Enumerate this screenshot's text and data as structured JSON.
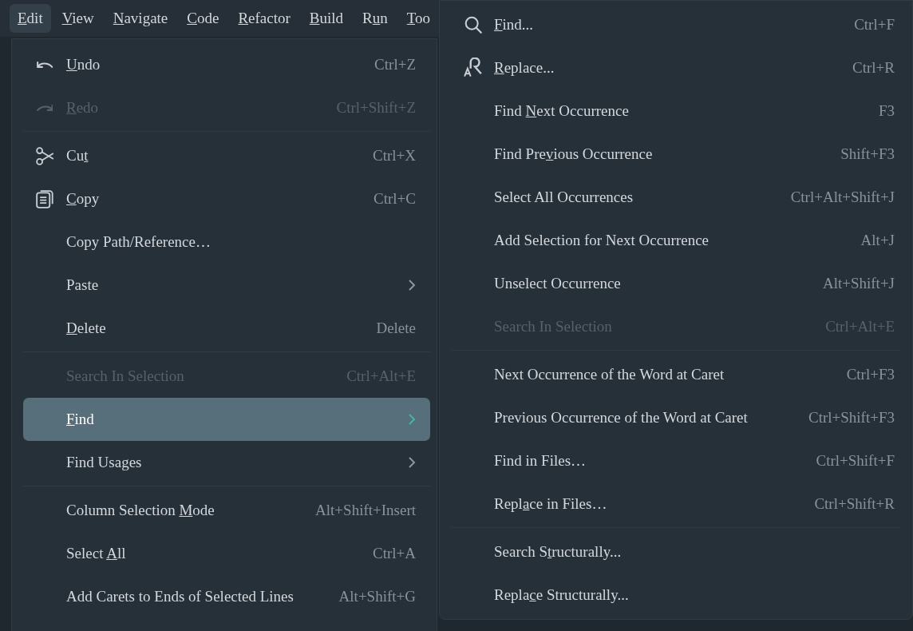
{
  "menubar": [
    {
      "label_parts": {
        "mnemonic": "E",
        "after": "dit"
      },
      "selected": true
    },
    {
      "label_parts": {
        "mnemonic": "V",
        "after": "iew"
      },
      "selected": false
    },
    {
      "label_parts": {
        "mnemonic": "N",
        "after": "avigate"
      },
      "selected": false
    },
    {
      "label_parts": {
        "mnemonic": "C",
        "after": "ode"
      },
      "selected": false
    },
    {
      "label_parts": {
        "mnemonic": "R",
        "after": "efactor"
      },
      "selected": false
    },
    {
      "label_parts": {
        "mnemonic": "B",
        "after": "uild"
      },
      "selected": false
    },
    {
      "label_parts": {
        "before": "R",
        "mnemonic": "u",
        "after": "n"
      },
      "selected": false
    },
    {
      "label_parts": {
        "mnemonic": "T",
        "after": "oo"
      },
      "selected": false
    }
  ],
  "edit_menu": [
    {
      "kind": "undo",
      "label_parts": {
        "mnemonic": "U",
        "after": "ndo"
      },
      "shortcut": "Ctrl+Z",
      "disabled": false
    },
    {
      "kind": "redo",
      "label_parts": {
        "mnemonic": "R",
        "after": "edo"
      },
      "shortcut": "Ctrl+Shift+Z",
      "disabled": true
    },
    {
      "kind": "separator"
    },
    {
      "kind": "cut",
      "label_parts": {
        "before": "Cu",
        "mnemonic": "t"
      },
      "shortcut": "Ctrl+X",
      "disabled": false
    },
    {
      "kind": "copy",
      "label_parts": {
        "mnemonic": "C",
        "after": "opy"
      },
      "shortcut": "Ctrl+C",
      "disabled": false
    },
    {
      "kind": "item",
      "label": "Copy Path/Reference…",
      "disabled": false
    },
    {
      "kind": "item",
      "label": "Paste",
      "submenu": true,
      "disabled": false
    },
    {
      "kind": "item",
      "label_parts": {
        "mnemonic": "D",
        "after": "elete"
      },
      "shortcut": "Delete",
      "disabled": false
    },
    {
      "kind": "separator"
    },
    {
      "kind": "item",
      "label": "Search In Selection",
      "shortcut": "Ctrl+Alt+E",
      "disabled": true
    },
    {
      "kind": "item",
      "label_parts": {
        "mnemonic": "F",
        "after": "ind"
      },
      "submenu": true,
      "selected": true,
      "disabled": false
    },
    {
      "kind": "item",
      "label": "Find Usages",
      "submenu": true,
      "disabled": false
    },
    {
      "kind": "separator"
    },
    {
      "kind": "item",
      "label_parts": {
        "before": "Column Selection ",
        "mnemonic": "M",
        "after": "ode"
      },
      "shortcut": "Alt+Shift+Insert",
      "disabled": false
    },
    {
      "kind": "item",
      "label_parts": {
        "before": "Select ",
        "mnemonic": "A",
        "after": "ll"
      },
      "shortcut": "Ctrl+A",
      "disabled": false
    },
    {
      "kind": "item",
      "label": "Add Carets to Ends of Selected Lines",
      "shortcut": "Alt+Shift+G",
      "disabled": false
    }
  ],
  "find_submenu": [
    {
      "kind": "search",
      "label_parts": {
        "mnemonic": "F",
        "after": "ind..."
      },
      "shortcut": "Ctrl+F",
      "disabled": false
    },
    {
      "kind": "replace",
      "label_parts": {
        "mnemonic": "R",
        "after": "eplace..."
      },
      "shortcut": "Ctrl+R",
      "disabled": false
    },
    {
      "kind": "item",
      "label_parts": {
        "before": "Find ",
        "mnemonic": "N",
        "after": "ext Occurrence"
      },
      "shortcut": "F3",
      "disabled": false
    },
    {
      "kind": "item",
      "label_parts": {
        "before": "Find Pre",
        "mnemonic": "v",
        "after": "ious Occurrence"
      },
      "shortcut": "Shift+F3",
      "disabled": false
    },
    {
      "kind": "item",
      "label": "Select All Occurrences",
      "shortcut": "Ctrl+Alt+Shift+J",
      "disabled": false
    },
    {
      "kind": "item",
      "label": "Add Selection for Next Occurrence",
      "shortcut": "Alt+J",
      "disabled": false
    },
    {
      "kind": "item",
      "label": "Unselect Occurrence",
      "shortcut": "Alt+Shift+J",
      "disabled": false
    },
    {
      "kind": "item",
      "label": "Search In Selection",
      "shortcut": "Ctrl+Alt+E",
      "disabled": true
    },
    {
      "kind": "separator"
    },
    {
      "kind": "item",
      "label": "Next Occurrence of the Word at Caret",
      "shortcut": "Ctrl+F3",
      "disabled": false
    },
    {
      "kind": "item",
      "label": "Previous Occurrence of the Word at Caret",
      "shortcut": "Ctrl+Shift+F3",
      "disabled": false
    },
    {
      "kind": "item",
      "label": "Find in Files…",
      "shortcut": "Ctrl+Shift+F",
      "disabled": false
    },
    {
      "kind": "item",
      "label_parts": {
        "before": "Repl",
        "mnemonic": "a",
        "after": "ce in Files…"
      },
      "shortcut": "Ctrl+Shift+R",
      "disabled": false
    },
    {
      "kind": "separator"
    },
    {
      "kind": "item",
      "label_parts": {
        "before": "Search S",
        "mnemonic": "t",
        "after": "ructurally..."
      },
      "disabled": false
    },
    {
      "kind": "item",
      "label_parts": {
        "before": "Repla",
        "mnemonic": "c",
        "after": "e Structurally..."
      },
      "disabled": false
    }
  ]
}
